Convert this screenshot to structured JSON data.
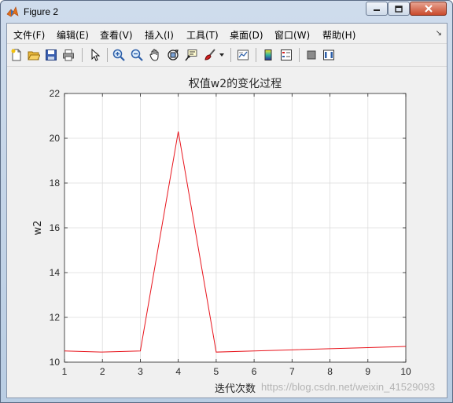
{
  "window": {
    "title": "Figure 2"
  },
  "menu": {
    "items": [
      "文件(F)",
      "编辑(E)",
      "查看(V)",
      "插入(I)",
      "工具(T)",
      "桌面(D)",
      "窗口(W)",
      "帮助(H)"
    ]
  },
  "toolbar": {
    "icons": [
      "new-figure-icon",
      "open-file-icon",
      "save-icon",
      "print-icon",
      "pointer-icon",
      "zoom-in-icon",
      "zoom-out-icon",
      "pan-icon",
      "rotate-3d-icon",
      "data-cursor-icon",
      "brush-icon",
      "link-plot-icon",
      "colorbar-icon",
      "legend-icon",
      "hide-plot-tools-icon",
      "show-plot-tools-icon"
    ]
  },
  "chart_data": {
    "type": "line",
    "title": "权值w2的变化过程",
    "xlabel": "迭代次数",
    "ylabel": "w2",
    "x": [
      1,
      2,
      3,
      4,
      5,
      6,
      7,
      8,
      9,
      10
    ],
    "series": [
      {
        "values": [
          10.5,
          10.45,
          10.5,
          20.3,
          10.45,
          10.5,
          10.55,
          10.6,
          10.65,
          10.7
        ],
        "color": "#e8141c"
      }
    ],
    "xlim": [
      1,
      10
    ],
    "ylim": [
      10,
      22
    ],
    "xticks": [
      "1",
      "2",
      "3",
      "4",
      "5",
      "6",
      "7",
      "8",
      "9",
      "10"
    ],
    "yticks": [
      "10",
      "12",
      "14",
      "16",
      "18",
      "20",
      "22"
    ],
    "grid": true
  },
  "watermark": "https://blog.csdn.net/weixin_41529093"
}
